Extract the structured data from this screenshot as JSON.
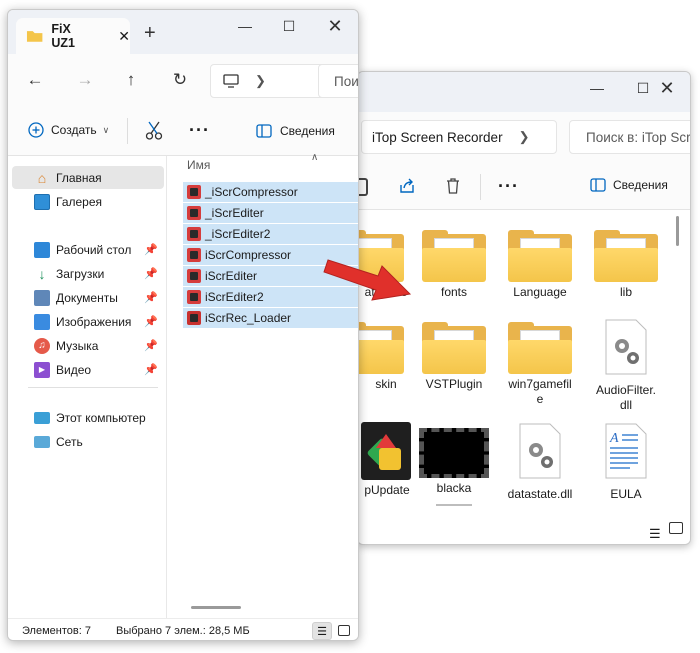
{
  "back_window": {
    "address_label": "iTop Screen Recorder",
    "search_placeholder": "Поиск в: iTop Scre",
    "toolbar_details": "Сведения",
    "tiles_row1": [
      "database",
      "fonts",
      "Language",
      "lib"
    ],
    "tiles_row2": [
      "skin",
      "VSTPlugin",
      "win7gamefile",
      "AudioFilter.dll"
    ],
    "tiles_row3": [
      "updater",
      "blacka",
      "datastate.dll",
      "EULA"
    ],
    "tile_label_database": "atabase",
    "tile_label_skin": "skin",
    "tile_label_updater": "pUpdate",
    "tile_label_win7": "win7gamefil\ne",
    "tile_label_audio": "AudioFilter.\ndll"
  },
  "front_window": {
    "tab_title": "FiX UZ1",
    "search_placeholder": "Пои",
    "toolbar": {
      "create_label": "Создать",
      "details_label": "Сведения"
    },
    "sidebar": {
      "home": "Главная",
      "gallery": "Галерея",
      "pinned": [
        "Рабочий стол",
        "Загрузки",
        "Документы",
        "Изображения",
        "Музыка",
        "Видео"
      ],
      "this_pc": "Этот компьютер",
      "network": "Сеть"
    },
    "column_header": "Имя",
    "files": [
      "_iScrCompressor",
      "_iScrEditer",
      "_iScrEditer2",
      "iScrCompressor",
      "iScrEditer",
      "iScrEditer2",
      "iScrRec_Loader"
    ],
    "status": {
      "items": "Элементов: 7",
      "selected": "Выбрано 7 элем.: 28,5 МБ"
    }
  },
  "colors": {
    "selection": "#cde4f7",
    "folder_yellow": "#f4c54a",
    "arrow_red": "#e0302b",
    "accent_blue": "#0067c0"
  }
}
